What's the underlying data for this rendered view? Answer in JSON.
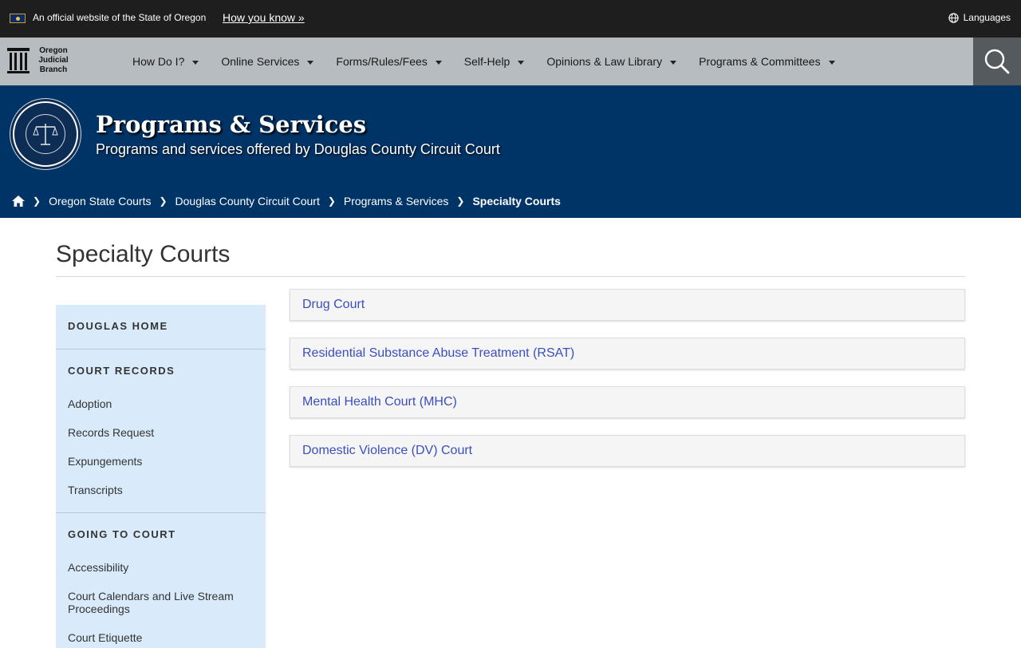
{
  "official_bar": {
    "text": "An official website of the State of Oregon",
    "how_link": "How you know »",
    "languages": "Languages"
  },
  "logo": {
    "line1": "Oregon",
    "line2": "Judicial",
    "line3": "Branch"
  },
  "nav": {
    "items": [
      {
        "label": "How Do I?"
      },
      {
        "label": "Online Services"
      },
      {
        "label": "Forms/Rules/Fees"
      },
      {
        "label": "Self-Help"
      },
      {
        "label": "Opinions & Law Library"
      },
      {
        "label": "Programs & Committees"
      }
    ]
  },
  "banner": {
    "title": "Programs & Services",
    "subtitle": "Programs and services offered by Douglas County Circuit Court"
  },
  "breadcrumb": {
    "items": [
      "Oregon State Courts",
      "Douglas County Circuit Court",
      "Programs & Services"
    ],
    "current": "Specialty Courts"
  },
  "page": {
    "title": "Specialty Courts"
  },
  "sidebar": {
    "home": "DOUGLAS HOME",
    "court_records": {
      "heading": "COURT RECORDS",
      "links": [
        "Adoption",
        "Records Request",
        "Expungements",
        "Transcripts"
      ]
    },
    "going_to_court": {
      "heading": "GOING TO COURT",
      "links": [
        "Accessibility",
        "Court Calendars and Live Stream Proceedings",
        "Court Etiquette"
      ]
    }
  },
  "accordions": [
    "Drug Court",
    "Residential Substance Abuse Treatment (RSAT)",
    "Mental Health Court (MHC)",
    "Domestic Violence (DV) Court"
  ],
  "colors": {
    "official_bar": "#1e1e1e",
    "nav_bg": "#b6bcc0",
    "banner_bg": "#003366",
    "sidebar_bg": "#d9ebfb",
    "link": "#3a4fbf"
  }
}
